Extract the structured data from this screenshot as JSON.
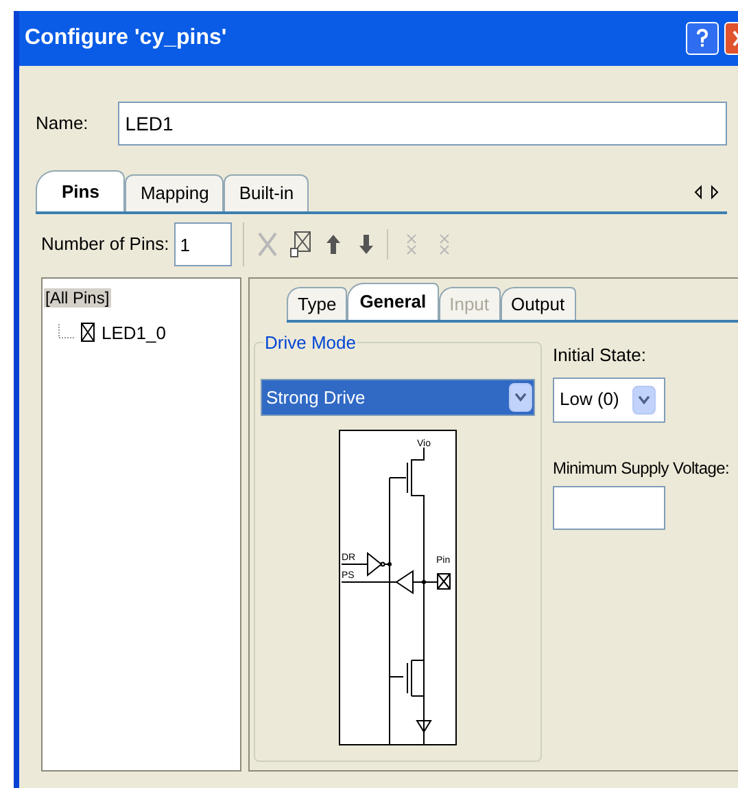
{
  "window": {
    "title": "Configure 'cy_pins'"
  },
  "name_field": {
    "label": "Name:",
    "value": "LED1"
  },
  "tabs": [
    {
      "label": "Pins",
      "selected": true
    },
    {
      "label": "Mapping",
      "selected": false
    },
    {
      "label": "Built-in",
      "selected": false
    }
  ],
  "pin_count": {
    "label": "Number of Pins:",
    "value": "1"
  },
  "toolbar": [
    {
      "kind": "delete",
      "disabled": true
    },
    {
      "kind": "box",
      "disabled": false
    },
    {
      "kind": "up",
      "disabled": false
    },
    {
      "kind": "down",
      "disabled": false
    },
    {
      "kind": "pair",
      "disabled": true
    },
    {
      "kind": "pair",
      "disabled": true
    }
  ],
  "tree": {
    "root": "[All Pins]",
    "children": [
      {
        "label": "LED1_0"
      }
    ]
  },
  "sub_tabs": [
    {
      "label": "Type",
      "selected": false,
      "disabled": false
    },
    {
      "label": "General",
      "selected": true,
      "disabled": false
    },
    {
      "label": "Input",
      "selected": false,
      "disabled": true
    },
    {
      "label": "Output",
      "selected": false,
      "disabled": false
    }
  ],
  "drive_mode": {
    "label": "Drive Mode",
    "value": "Strong Drive"
  },
  "schematic": {
    "supply": "Vio",
    "inputs": [
      "DR",
      "PS"
    ],
    "pin": "Pin"
  },
  "initial_state": {
    "label": "Initial State:",
    "value": "Low (0)"
  },
  "min_supply": {
    "label": "Minimum Supply Voltage:"
  }
}
